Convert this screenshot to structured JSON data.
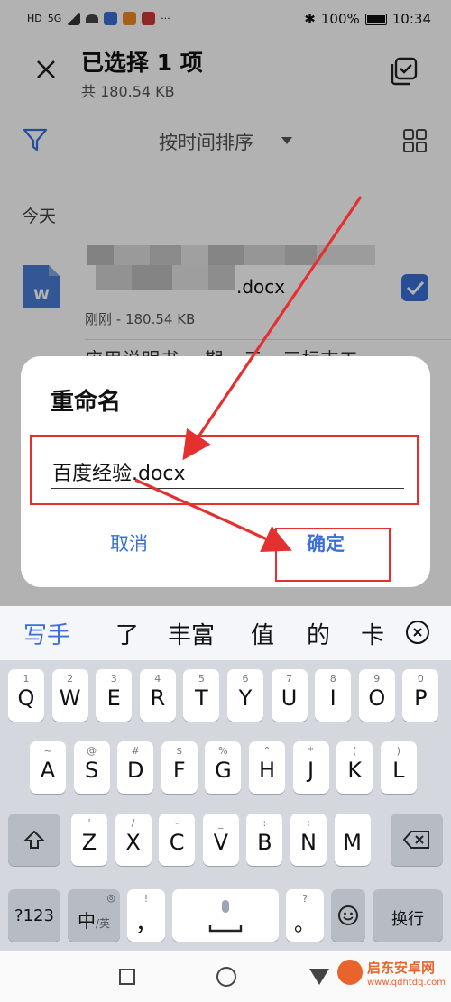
{
  "status_bar": {
    "left_labels": [
      "HD",
      "5G"
    ],
    "battery": "100%",
    "time": "10:34"
  },
  "header": {
    "title": "已选择 1 项",
    "subtitle": "共 180.54 KB"
  },
  "toolbar": {
    "sort_label": "按时间排序"
  },
  "section": {
    "today": "今天"
  },
  "file": {
    "icon_letter": "W",
    "name_suffix": ".docx",
    "meta": "刚刚 - 180.54 KB",
    "checked": true,
    "second_peek": "应用说明书 一期 · 三 · 三标志工"
  },
  "dialog": {
    "title": "重命名",
    "input_value": "百度经验.docx",
    "cancel_label": "取消",
    "confirm_label": "确定"
  },
  "candidates": {
    "mode": "写手",
    "items": [
      "了",
      "丰富",
      "值",
      "的",
      "卡"
    ]
  },
  "keyboard": {
    "row1": [
      {
        "hint": "1",
        "key": "Q"
      },
      {
        "hint": "2",
        "key": "W"
      },
      {
        "hint": "3",
        "key": "E"
      },
      {
        "hint": "4",
        "key": "R"
      },
      {
        "hint": "5",
        "key": "T"
      },
      {
        "hint": "6",
        "key": "Y"
      },
      {
        "hint": "7",
        "key": "U"
      },
      {
        "hint": "8",
        "key": "I"
      },
      {
        "hint": "9",
        "key": "O"
      },
      {
        "hint": "0",
        "key": "P"
      }
    ],
    "row2": [
      {
        "hint": "~",
        "key": "A"
      },
      {
        "hint": "@",
        "key": "S"
      },
      {
        "hint": "#",
        "key": "D"
      },
      {
        "hint": "$",
        "key": "F"
      },
      {
        "hint": "%",
        "key": "G"
      },
      {
        "hint": "^",
        "key": "H"
      },
      {
        "hint": "*",
        "key": "J"
      },
      {
        "hint": "(",
        "key": "K"
      },
      {
        "hint": ")",
        "key": "L"
      }
    ],
    "row3": [
      {
        "hint": "'",
        "key": "Z"
      },
      {
        "hint": "/",
        "key": "X"
      },
      {
        "hint": "-",
        "key": "C"
      },
      {
        "hint": "_",
        "key": "V"
      },
      {
        "hint": ":",
        "key": "B"
      },
      {
        "hint": ";",
        "key": "N"
      },
      {
        "hint": "",
        "key": "M"
      }
    ],
    "bottom": {
      "num_label": "?123",
      "lang_main": "中",
      "lang_sub": "/英",
      "comma_hint": "!",
      "comma": "，",
      "period_hint": "?",
      "period": "。",
      "enter_label": "换行"
    }
  },
  "watermark": {
    "name": "启东安卓网",
    "url": "www.qdhtdq.com"
  },
  "colors": {
    "accent": "#3a6fd8",
    "annotation": "#e53030",
    "keyboard_bg": "#d4d7dd"
  }
}
